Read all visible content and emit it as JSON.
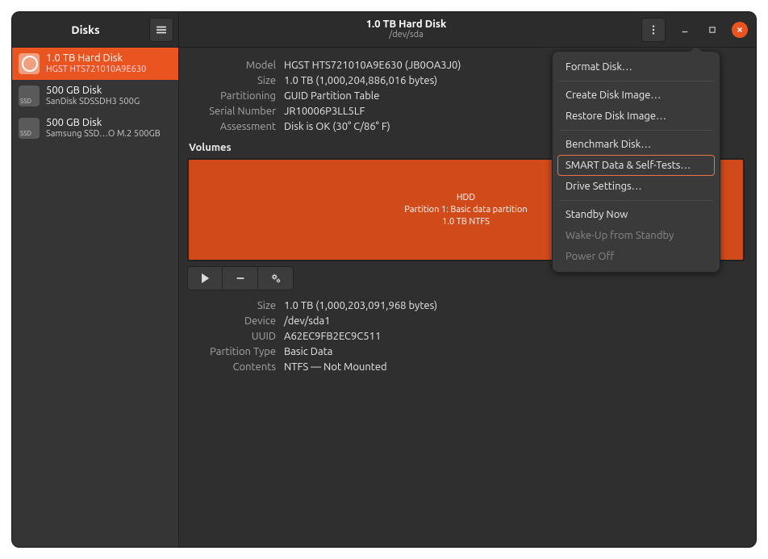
{
  "app": {
    "title": "Disks"
  },
  "header": {
    "disk_title": "1.0 TB Hard Disk",
    "disk_device": "/dev/sda"
  },
  "sidebar": {
    "disks": [
      {
        "name": "1.0 TB Hard Disk",
        "sub": "HGST HTS721010A9E630",
        "type": "hdd",
        "selected": true
      },
      {
        "name": "500 GB Disk",
        "sub": "SanDisk SDSSDH3 500G",
        "type": "ssd",
        "selected": false
      },
      {
        "name": "500 GB Disk",
        "sub": "Samsung SSD…O M.2 500GB",
        "type": "ssd",
        "selected": false
      }
    ]
  },
  "drive": {
    "model_label": "Model",
    "model": "HGST HTS721010A9E630 (JB0OA3J0)",
    "size_label": "Size",
    "size": "1.0 TB (1,000,204,886,016 bytes)",
    "partitioning_label": "Partitioning",
    "partitioning": "GUID Partition Table",
    "serial_label": "Serial Number",
    "serial": "JR10006P3LL5LF",
    "assessment_label": "Assessment",
    "assessment": "Disk is OK (30° C/86° F)"
  },
  "volumes": {
    "section_title": "Volumes",
    "partition_title": "HDD",
    "partition_desc": "Partition 1: Basic data partition",
    "partition_size": "1.0 TB NTFS"
  },
  "volume_details": {
    "size_label": "Size",
    "size": "1.0 TB (1,000,203,091,968 bytes)",
    "device_label": "Device",
    "device": "/dev/sda1",
    "uuid_label": "UUID",
    "uuid": "A62EC9FB2EC9C511",
    "ptype_label": "Partition Type",
    "ptype": "Basic Data",
    "contents_label": "Contents",
    "contents": "NTFS — Not Mounted"
  },
  "menu": {
    "format": "Format Disk…",
    "create_image": "Create Disk Image…",
    "restore_image": "Restore Disk Image…",
    "benchmark": "Benchmark Disk…",
    "smart": "SMART Data & Self-Tests…",
    "drive_settings": "Drive Settings…",
    "standby_now": "Standby Now",
    "wakeup": "Wake-Up from Standby",
    "power_off": "Power Off"
  },
  "icons": {
    "ssd_label": "SSD"
  }
}
